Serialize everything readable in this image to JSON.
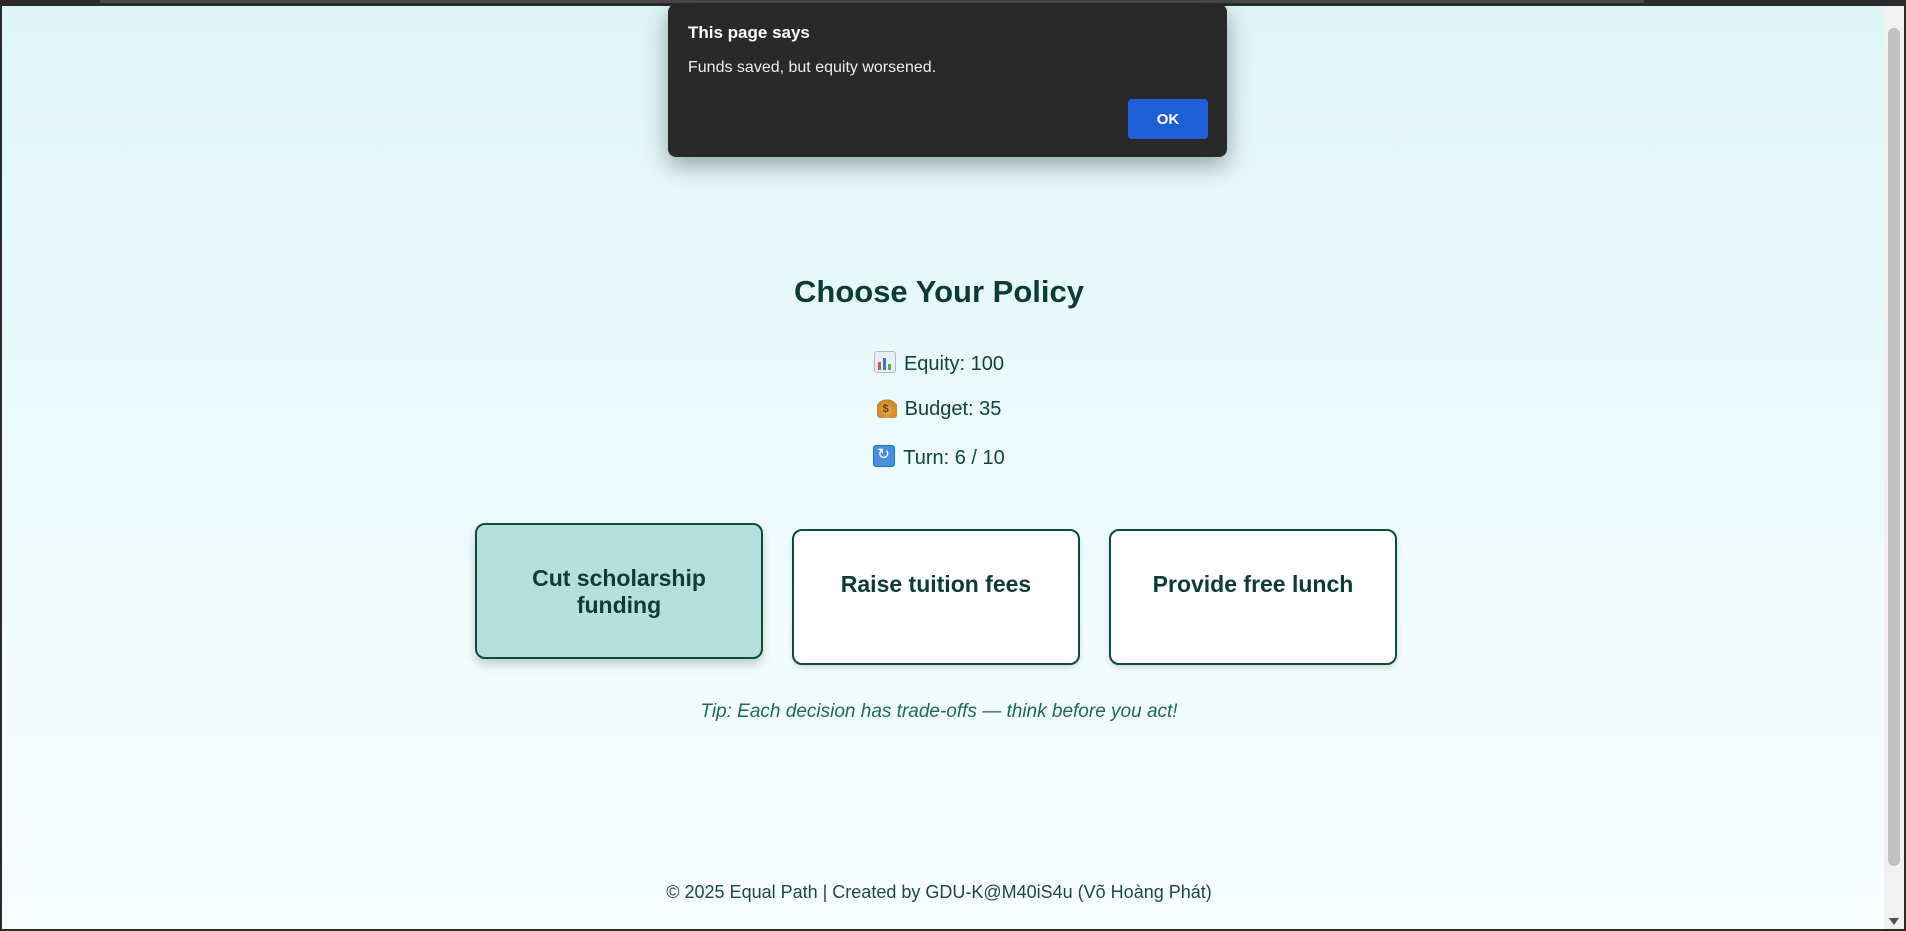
{
  "dialog": {
    "title": "This page says",
    "message": "Funds saved, but equity worsened.",
    "ok_label": "OK"
  },
  "game": {
    "title": "Choose Your Policy",
    "stats": {
      "equity": "Equity: 100",
      "budget": "Budget: 35",
      "turn": "Turn: 6 / 10"
    },
    "icons": [
      "bar-chart-icon",
      "money-bag-icon",
      "cycle-icon"
    ],
    "policies": [
      {
        "label": "Cut scholarship funding",
        "selected": true
      },
      {
        "label": "Raise tuition fees",
        "selected": false
      },
      {
        "label": "Provide free lunch",
        "selected": false
      }
    ],
    "tip": "Tip: Each decision has trade-offs — think before you act!"
  },
  "footer": {
    "text": "© 2025 Equal Path | Created by GDU-K@M40iS4u (Võ Hoàng Phát)"
  },
  "colors": {
    "accent": "#0f4a41",
    "selected_card": "#b3e0dd",
    "ok_button": "#1d5fd6",
    "dialog_bg": "#292929"
  }
}
